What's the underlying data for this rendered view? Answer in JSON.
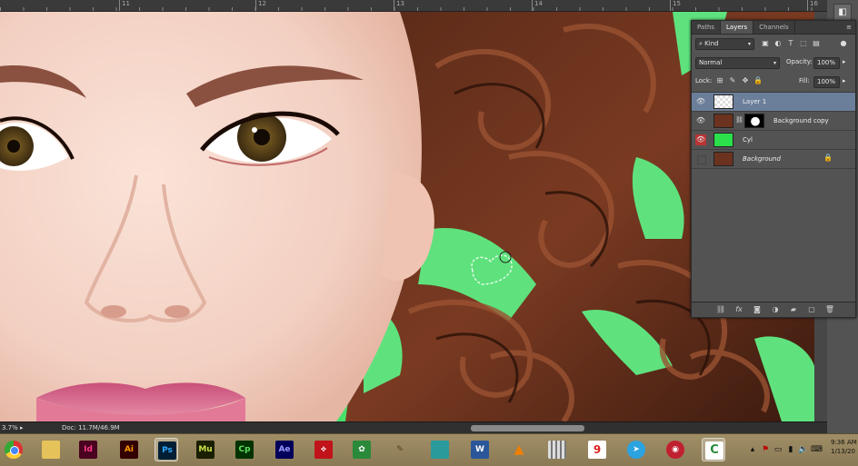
{
  "ruler": {
    "ticks": [
      "11",
      "12",
      "13",
      "14",
      "15",
      "16"
    ]
  },
  "status": {
    "zoom": "3.7%",
    "doc": "Doc: 11.7M/46.9M"
  },
  "panel": {
    "tabs": [
      "Paths",
      "Layers",
      "Channels"
    ],
    "active_tab": "Layers",
    "filter_kind": "Kind",
    "blend_mode": "Normal",
    "opacity_label": "Opacity:",
    "opacity_value": "100%",
    "lock_label": "Lock:",
    "fill_label": "Fill:",
    "fill_value": "100%",
    "layers": [
      {
        "name": "Layer 1",
        "active": true,
        "visible": true
      },
      {
        "name": "Background copy",
        "active": false,
        "visible": true
      },
      {
        "name": "Cyl",
        "active": false,
        "visible": true
      },
      {
        "name": "Background",
        "active": false,
        "visible": false
      }
    ]
  },
  "taskbar": {
    "apps": [
      {
        "icon": "chrome-icon",
        "label": ""
      },
      {
        "icon": "folder-icon",
        "label": ""
      },
      {
        "icon": "indesign-icon",
        "label": "Id"
      },
      {
        "icon": "illustrator-icon",
        "label": "Ai"
      },
      {
        "icon": "photoshop-icon",
        "label": "Ps"
      },
      {
        "icon": "muse-icon",
        "label": "Mu"
      },
      {
        "icon": "captivate-icon",
        "label": "Cp"
      },
      {
        "icon": "aftereffects-icon",
        "label": "Ae"
      },
      {
        "icon": "acrobat-icon",
        "label": ""
      },
      {
        "icon": "corel-icon",
        "label": ""
      },
      {
        "icon": "brush-icon",
        "label": ""
      },
      {
        "icon": "app-icon",
        "label": ""
      },
      {
        "icon": "word-icon",
        "label": "W"
      },
      {
        "icon": "vlc-icon",
        "label": ""
      },
      {
        "icon": "grid-icon",
        "label": ""
      },
      {
        "icon": "nine-icon",
        "label": "9"
      },
      {
        "icon": "telegram-icon",
        "label": ""
      },
      {
        "icon": "eye-app-icon",
        "label": ""
      },
      {
        "icon": "camtasia-icon",
        "label": "C"
      }
    ],
    "time": "9:36 AM",
    "date": "1/13/20"
  },
  "colors": {
    "panel_bg": "#535353",
    "active_layer": "#6b7e9a",
    "green_bg": "#48e06a",
    "taskbar": "#9a8860"
  }
}
